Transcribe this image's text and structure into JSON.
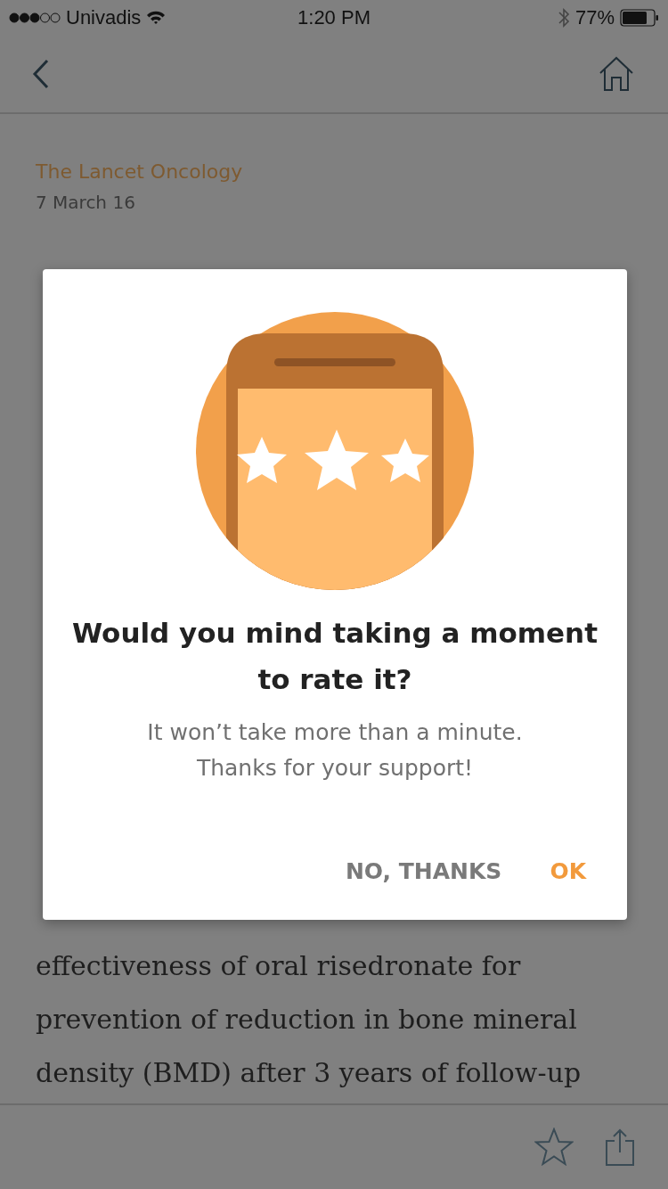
{
  "status_bar": {
    "carrier": "Univadis",
    "time": "1:20 PM",
    "battery": "77%"
  },
  "article": {
    "source": "The Lancet Oncology",
    "date": "7 March 16",
    "lines": [
      "effectiveness of oral risedronate for",
      "prevention of reduction in bone mineral",
      "density (BMD) after 3 years of follow-up"
    ]
  },
  "dialog": {
    "title": "Would you mind taking a moment to rate it?",
    "message": [
      "It won’t take more than a minute.",
      "Thanks for your support!"
    ],
    "buttons": [
      {
        "label": "NO, THANKS",
        "kind": "secondary"
      },
      {
        "label": "OK",
        "kind": "primary"
      }
    ]
  }
}
